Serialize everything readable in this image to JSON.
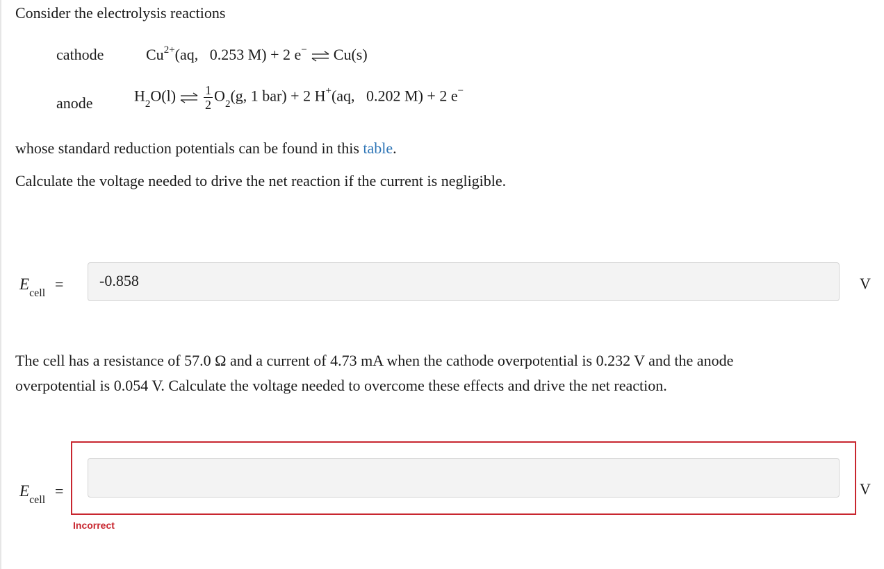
{
  "intro": "Consider the electrolysis reactions",
  "cathode": {
    "label": "cathode",
    "species": "Cu",
    "charge": "2+",
    "conditions": "(aq,  0.253 M) + 2 e",
    "electron_sup": "−",
    "product": "Cu(s)"
  },
  "anode": {
    "label": "anode",
    "h2o_h": "H",
    "h2o_sub": "2",
    "h2o_rest": "O(l)",
    "frac_num": "1",
    "frac_den": "2",
    "o2": "O",
    "o2_sub": "2",
    "o2_rest": "(g, 1 bar) + 2 H",
    "h_sup": "+",
    "h_rest": "(aq,  0.202 M) + 2 e",
    "e_sup": "−"
  },
  "standard_text": "whose standard reduction potentials can be found in this ",
  "table_link": "table",
  "standard_end": ".",
  "question1": "Calculate the voltage needed to drive the net reaction if the current is negligible.",
  "answer1": {
    "symbol": "E",
    "subscript": "cell",
    "equals": "=",
    "value": "-0.858",
    "unit": "V"
  },
  "question2_line1": "The cell has a resistance of 57.0 Ω and a current of 4.73 mA when the cathode overpotential is 0.232 V and the anode",
  "question2_line2": "overpotential is 0.054 V. Calculate the voltage needed to overcome these effects and drive the net reaction.",
  "answer2": {
    "symbol": "E",
    "subscript": "cell",
    "equals": "=",
    "value": "",
    "unit": "V",
    "feedback": "Incorrect"
  },
  "colors": {
    "link": "#2e75b6",
    "error": "#c8262f",
    "input_bg": "#f3f3f3"
  }
}
